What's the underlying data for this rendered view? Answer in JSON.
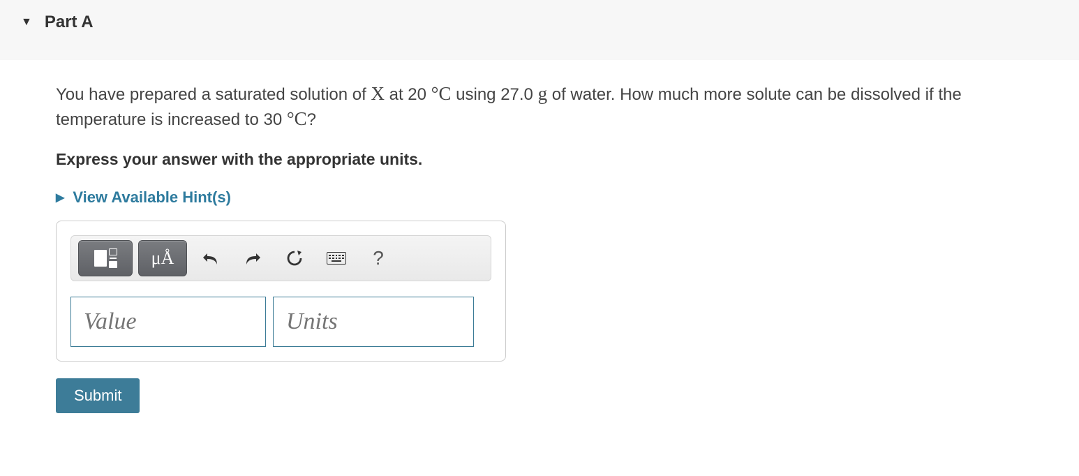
{
  "part": {
    "label": "Part A"
  },
  "question": {
    "pre": "You have prepared a saturated solution of ",
    "var": "X",
    "at": " at 20 ",
    "deg1": "°C",
    "mid": " using 27.0 ",
    "g": "g",
    "post1": " of water. How much more solute can be dissolved if the temperature is increased to 30 ",
    "deg2": "°C",
    "qmark": "?"
  },
  "instruction": "Express your answer with the appropriate units.",
  "hints": {
    "label": "View Available Hint(s)"
  },
  "toolbar": {
    "units_label": "μÅ",
    "help_label": "?"
  },
  "inputs": {
    "value_placeholder": "Value",
    "units_placeholder": "Units"
  },
  "submit": {
    "label": "Submit"
  }
}
